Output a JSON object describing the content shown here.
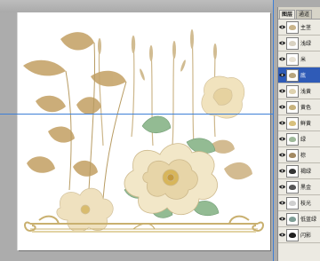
{
  "panel": {
    "tabs": [
      "图层",
      "通道"
    ],
    "layers": [
      {
        "name": "主茎",
        "thumb_color": "#c9b48a"
      },
      {
        "name": "浅绿",
        "thumb_color": "#d9d2c2"
      },
      {
        "name": "米",
        "thumb_color": "#e8e2d4"
      },
      {
        "name": "底",
        "thumb_color": "#b8a57e",
        "selected": true
      },
      {
        "name": "浅黄",
        "thumb_color": "#ded2b0"
      },
      {
        "name": "黄色",
        "thumb_color": "#c7b27c"
      },
      {
        "name": "鲜黄",
        "thumb_color": "#d8c07c"
      },
      {
        "name": "绿",
        "thumb_color": "#9fb99a"
      },
      {
        "name": "棕",
        "thumb_color": "#a38a63"
      },
      {
        "name": "褐绿",
        "thumb_color": "#343434"
      },
      {
        "name": "黑金",
        "thumb_color": "#555555"
      },
      {
        "name": "枝光",
        "thumb_color": "#cfcfcf"
      },
      {
        "name": "低蓝绿",
        "thumb_color": "#7f9e96"
      },
      {
        "name": "闪影",
        "thumb_color": "#202020"
      }
    ]
  },
  "colors": {
    "canvas_bg": "#ffffff",
    "workspace": "#acacac",
    "guide": "#3d7fd6",
    "leaf_gold": "#c4a46c",
    "leaf_light": "#d9c29a",
    "petal": "#f3ead0",
    "petal_shade": "#e4d3a6",
    "stamen": "#d9b85b",
    "green_leaf": "#8fb88f",
    "frame": "#c9b06f"
  }
}
